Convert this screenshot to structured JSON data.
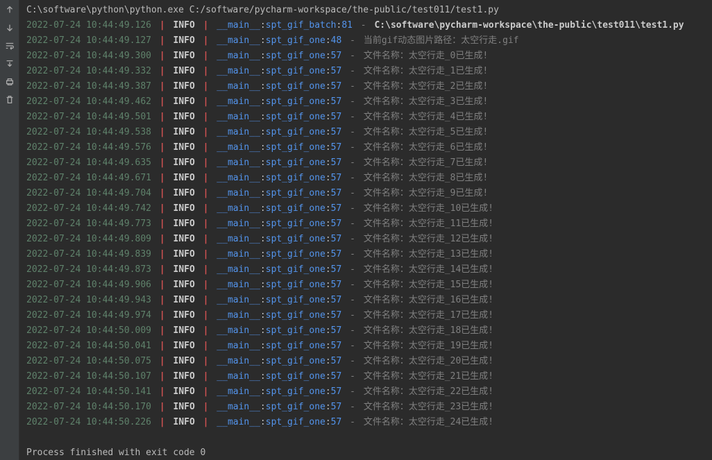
{
  "command_line": "C:\\software\\python\\python.exe C:/software/pycharm-workspace/the-public/test011/test1.py",
  "footer": "Process finished with exit code 0",
  "log_common": {
    "level": "INFO",
    "module": "__main__"
  },
  "logs": [
    {
      "ts": "2022-07-24 10:44:49.126",
      "func": "spt_gif_batch",
      "line": "81",
      "msg": "C:\\software\\pycharm-workspace\\the-public\\test011\\test1.py",
      "bold": true
    },
    {
      "ts": "2022-07-24 10:44:49.127",
      "func": "spt_gif_one",
      "line": "48",
      "msg": "当前gif动态图片路径：太空行走.gif",
      "bold": false
    },
    {
      "ts": "2022-07-24 10:44:49.300",
      "func": "spt_gif_one",
      "line": "57",
      "msg": "文件名称：太空行走_0已生成!",
      "bold": false
    },
    {
      "ts": "2022-07-24 10:44:49.332",
      "func": "spt_gif_one",
      "line": "57",
      "msg": "文件名称：太空行走_1已生成!",
      "bold": false
    },
    {
      "ts": "2022-07-24 10:44:49.387",
      "func": "spt_gif_one",
      "line": "57",
      "msg": "文件名称：太空行走_2已生成!",
      "bold": false
    },
    {
      "ts": "2022-07-24 10:44:49.462",
      "func": "spt_gif_one",
      "line": "57",
      "msg": "文件名称：太空行走_3已生成!",
      "bold": false
    },
    {
      "ts": "2022-07-24 10:44:49.501",
      "func": "spt_gif_one",
      "line": "57",
      "msg": "文件名称：太空行走_4已生成!",
      "bold": false
    },
    {
      "ts": "2022-07-24 10:44:49.538",
      "func": "spt_gif_one",
      "line": "57",
      "msg": "文件名称：太空行走_5已生成!",
      "bold": false
    },
    {
      "ts": "2022-07-24 10:44:49.576",
      "func": "spt_gif_one",
      "line": "57",
      "msg": "文件名称：太空行走_6已生成!",
      "bold": false
    },
    {
      "ts": "2022-07-24 10:44:49.635",
      "func": "spt_gif_one",
      "line": "57",
      "msg": "文件名称：太空行走_7已生成!",
      "bold": false
    },
    {
      "ts": "2022-07-24 10:44:49.671",
      "func": "spt_gif_one",
      "line": "57",
      "msg": "文件名称：太空行走_8已生成!",
      "bold": false
    },
    {
      "ts": "2022-07-24 10:44:49.704",
      "func": "spt_gif_one",
      "line": "57",
      "msg": "文件名称：太空行走_9已生成!",
      "bold": false
    },
    {
      "ts": "2022-07-24 10:44:49.742",
      "func": "spt_gif_one",
      "line": "57",
      "msg": "文件名称：太空行走_10已生成!",
      "bold": false
    },
    {
      "ts": "2022-07-24 10:44:49.773",
      "func": "spt_gif_one",
      "line": "57",
      "msg": "文件名称：太空行走_11已生成!",
      "bold": false
    },
    {
      "ts": "2022-07-24 10:44:49.809",
      "func": "spt_gif_one",
      "line": "57",
      "msg": "文件名称：太空行走_12已生成!",
      "bold": false
    },
    {
      "ts": "2022-07-24 10:44:49.839",
      "func": "spt_gif_one",
      "line": "57",
      "msg": "文件名称：太空行走_13已生成!",
      "bold": false
    },
    {
      "ts": "2022-07-24 10:44:49.873",
      "func": "spt_gif_one",
      "line": "57",
      "msg": "文件名称：太空行走_14已生成!",
      "bold": false
    },
    {
      "ts": "2022-07-24 10:44:49.906",
      "func": "spt_gif_one",
      "line": "57",
      "msg": "文件名称：太空行走_15已生成!",
      "bold": false
    },
    {
      "ts": "2022-07-24 10:44:49.943",
      "func": "spt_gif_one",
      "line": "57",
      "msg": "文件名称：太空行走_16已生成!",
      "bold": false
    },
    {
      "ts": "2022-07-24 10:44:49.974",
      "func": "spt_gif_one",
      "line": "57",
      "msg": "文件名称：太空行走_17已生成!",
      "bold": false
    },
    {
      "ts": "2022-07-24 10:44:50.009",
      "func": "spt_gif_one",
      "line": "57",
      "msg": "文件名称：太空行走_18已生成!",
      "bold": false
    },
    {
      "ts": "2022-07-24 10:44:50.041",
      "func": "spt_gif_one",
      "line": "57",
      "msg": "文件名称：太空行走_19已生成!",
      "bold": false
    },
    {
      "ts": "2022-07-24 10:44:50.075",
      "func": "spt_gif_one",
      "line": "57",
      "msg": "文件名称：太空行走_20已生成!",
      "bold": false
    },
    {
      "ts": "2022-07-24 10:44:50.107",
      "func": "spt_gif_one",
      "line": "57",
      "msg": "文件名称：太空行走_21已生成!",
      "bold": false
    },
    {
      "ts": "2022-07-24 10:44:50.141",
      "func": "spt_gif_one",
      "line": "57",
      "msg": "文件名称：太空行走_22已生成!",
      "bold": false
    },
    {
      "ts": "2022-07-24 10:44:50.170",
      "func": "spt_gif_one",
      "line": "57",
      "msg": "文件名称：太空行走_23已生成!",
      "bold": false
    },
    {
      "ts": "2022-07-24 10:44:50.226",
      "func": "spt_gif_one",
      "line": "57",
      "msg": "文件名称：太空行走_24已生成!",
      "bold": false
    }
  ]
}
